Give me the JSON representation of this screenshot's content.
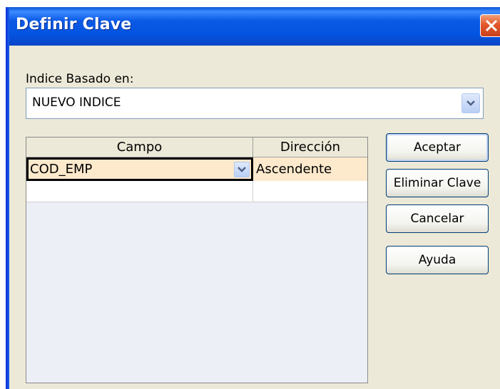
{
  "window": {
    "title": "Definir Clave"
  },
  "index_based_on": {
    "label": "Indice Basado en:",
    "selected_value": "NUEVO INDICE"
  },
  "grid": {
    "columns": [
      "Campo",
      "Dirección"
    ],
    "rows": [
      {
        "campo": "COD_EMP",
        "direccion": "Ascendente"
      },
      {
        "campo": "",
        "direccion": ""
      }
    ]
  },
  "buttons": {
    "accept": "Aceptar",
    "delete_key": "Eliminar Clave",
    "cancel": "Cancelar",
    "help": "Ayuda"
  },
  "colors": {
    "titlebar": "#0054e3",
    "dialog_bg": "#ece9d8",
    "selected_row": "#fde9cc",
    "close_button": "#e2582a"
  }
}
